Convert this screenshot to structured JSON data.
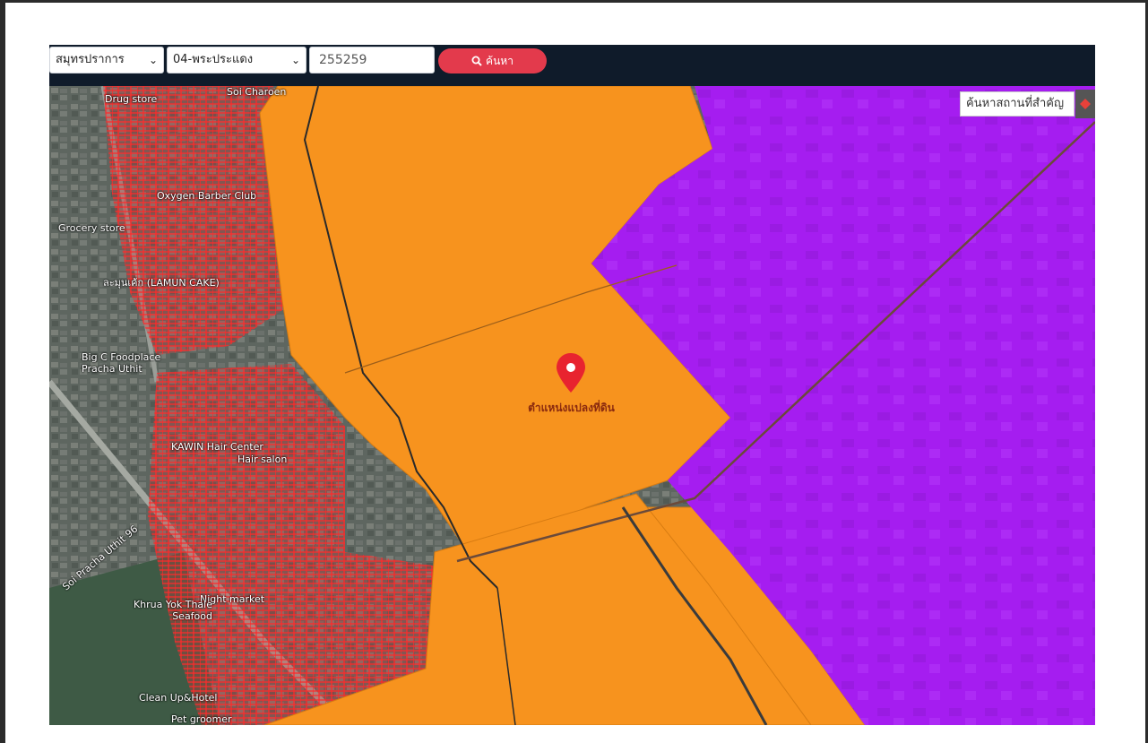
{
  "toolbar": {
    "province": "สมุทรปราการ",
    "district": "04-พระประแดง",
    "parcel_number": "255259",
    "search_label": "ค้นหา"
  },
  "map": {
    "place_search_placeholder": "ค้นหาสถานที่สำคัญ",
    "pin_label": "ตำแหน่งแปลงที่ดิน",
    "zone_colors": {
      "orange_zone": "#f7931e",
      "purple_zone": "#a51df0",
      "parcel_lines": "#ff2020"
    },
    "pois": [
      {
        "label": "Drug store"
      },
      {
        "label": "Soi Charoen"
      },
      {
        "label": "Oxygen Barber Club"
      },
      {
        "label": "Grocery store"
      },
      {
        "label": "ละมุนเค้ก (LAMUN CAKE)"
      },
      {
        "label": "Big C Foodplace Pracha Uthit"
      },
      {
        "label": "KAWIN Hair Center"
      },
      {
        "label": "Hair salon"
      },
      {
        "label": "Night market"
      },
      {
        "label": "Khrua Yok Thale Seafood"
      },
      {
        "label": "Clean Up&Hotel"
      },
      {
        "label": "Pet groomer"
      },
      {
        "label": "Soi Pracha Uthit 96"
      }
    ]
  }
}
